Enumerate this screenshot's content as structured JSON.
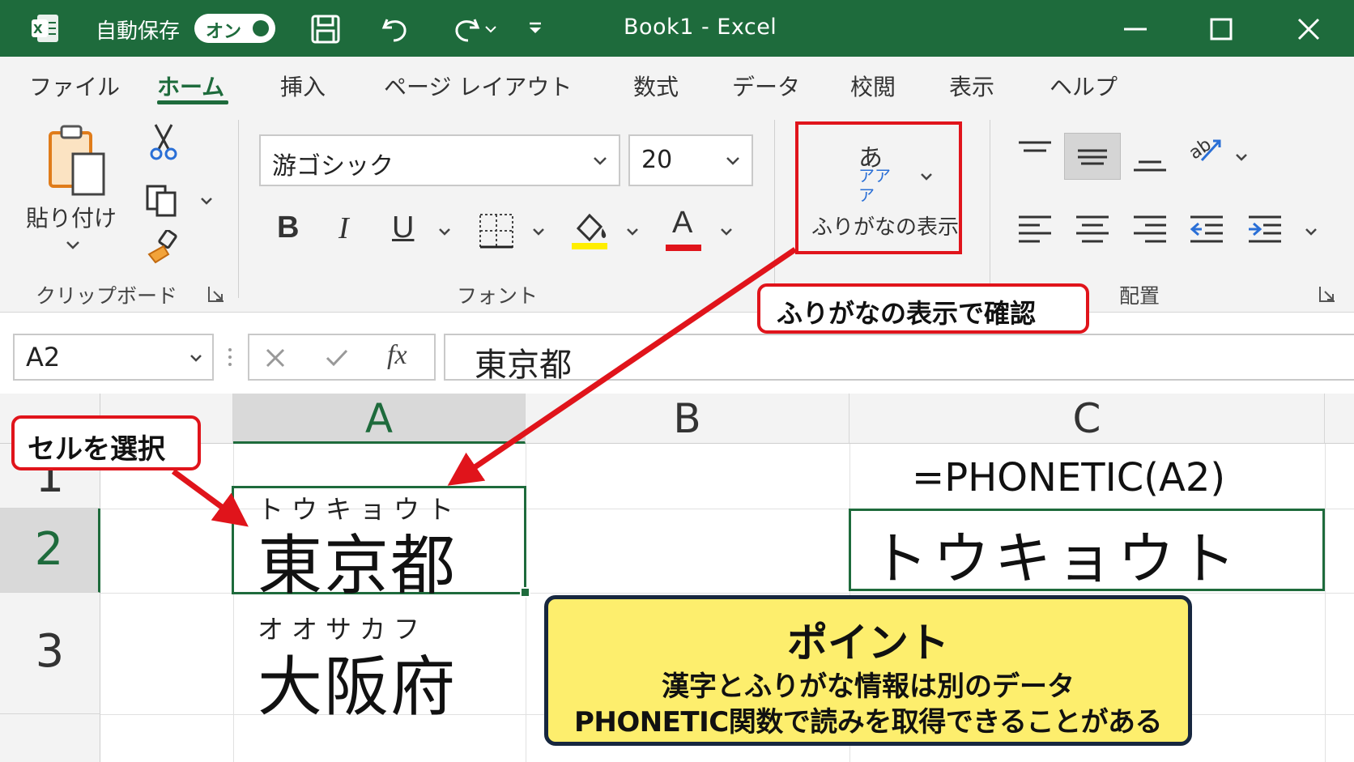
{
  "titlebar": {
    "autosave_label": "自動保存",
    "autosave_state": "オン",
    "title": "Book1 - Excel",
    "background": "#1e6b3c"
  },
  "tabs": [
    {
      "label": "ファイル"
    },
    {
      "label": "ホーム",
      "active": true
    },
    {
      "label": "挿入"
    },
    {
      "label": "ページ レイアウト"
    },
    {
      "label": "数式"
    },
    {
      "label": "データ"
    },
    {
      "label": "校閲"
    },
    {
      "label": "表示"
    },
    {
      "label": "ヘルプ"
    }
  ],
  "ribbon": {
    "clipboard": {
      "paste_label": "貼り付け",
      "group_label": "クリップボード",
      "icons": [
        "paste-icon",
        "cut-icon",
        "copy-icon",
        "format-painter-icon"
      ]
    },
    "font": {
      "font_name": "游ゴシック",
      "font_size": "20",
      "bold": "B",
      "italic": "I",
      "underline": "U",
      "font_color_letter": "A",
      "highlight_color": "#ffee00",
      "font_color": "#e0141b",
      "group_label": "フォント"
    },
    "furigana": {
      "icon_char": "あ",
      "icon_kana_top": "アア",
      "icon_kana_bottom": "ア",
      "label": "ふりがなの表示"
    },
    "alignment": {
      "group_label": "配置"
    }
  },
  "callouts": {
    "confirm": "ふりがなの表示で確認",
    "select": "セルを選択",
    "point": {
      "title": "ポイント",
      "line1": "漢字とふりがな情報は別のデータ",
      "line2": "PHONETIC関数で読みを取得できることがある"
    },
    "accent": "#e0141b"
  },
  "formula_bar": {
    "name_box": "A2",
    "fx": "fx",
    "content": "東京都"
  },
  "grid": {
    "columns": [
      "A",
      "B",
      "C"
    ],
    "rows": [
      "1",
      "2",
      "3"
    ],
    "selected_cell": "A2",
    "cells": {
      "A2_ruby": "トウキョウト",
      "A2_value": "東京都",
      "A3_ruby": "オオサカフ",
      "A3_value": "大阪府",
      "C1_formula": "=PHONETIC(A2)",
      "C2_value": "トウキョウト"
    }
  }
}
